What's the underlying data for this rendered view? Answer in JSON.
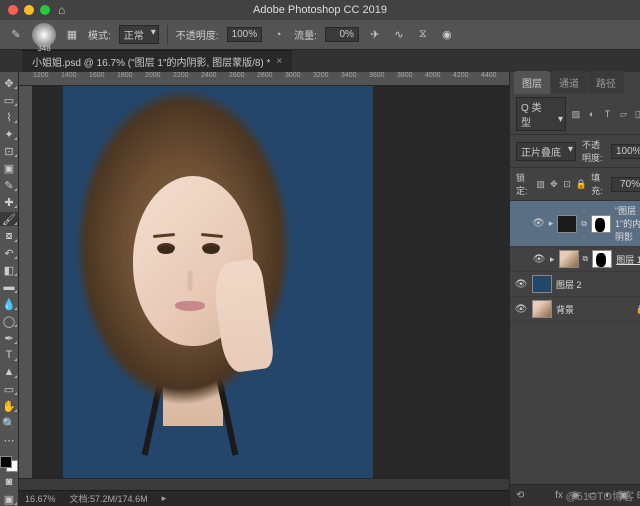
{
  "app_title": "Adobe Photoshop CC 2019",
  "optbar": {
    "brush_size": "348",
    "mode_label": "模式:",
    "mode_value": "正常",
    "opacity_label": "不透明度:",
    "opacity_value": "100%",
    "flow_label": "流量:",
    "flow_value": "0%"
  },
  "doc_tab": "小姐姐.psd @ 16.7% (\"图层 1\"的内阴影, 图层蒙版/8) *",
  "ruler_ticks": [
    "1200",
    "1400",
    "1600",
    "1800",
    "2000",
    "2200",
    "2400",
    "2600",
    "2800",
    "3000",
    "3200",
    "3400",
    "3600",
    "3800",
    "4000",
    "4200",
    "4400"
  ],
  "status": {
    "zoom": "16.67%",
    "docsize": "文档:57.2M/174.6M"
  },
  "panels": {
    "tabs": [
      "图层",
      "通道",
      "路径"
    ],
    "kind_label": "Q 类型",
    "blend_mode": "正片叠底",
    "opacity_label": "不透明度:",
    "opacity_value": "100%",
    "lock_label": "锁定:",
    "fill_label": "填充:",
    "fill_value": "70%",
    "layers": [
      {
        "name": "\"图层 1\"的内阴影",
        "selected": true,
        "indent": true,
        "thumbs": [
          "fx",
          "mask"
        ]
      },
      {
        "name": "图层 1",
        "underline": true,
        "indent": true,
        "thumbs": [
          "img",
          "mask"
        ]
      },
      {
        "name": "图层 2",
        "thumbs": [
          "solid"
        ]
      },
      {
        "name": "背景",
        "locked": true,
        "thumbs": [
          "img"
        ]
      }
    ],
    "foot_icons": [
      "fx",
      "◉",
      "▭",
      "◐",
      "▣",
      "⊞",
      "🗑"
    ]
  },
  "watermark": "@51CTO博客"
}
